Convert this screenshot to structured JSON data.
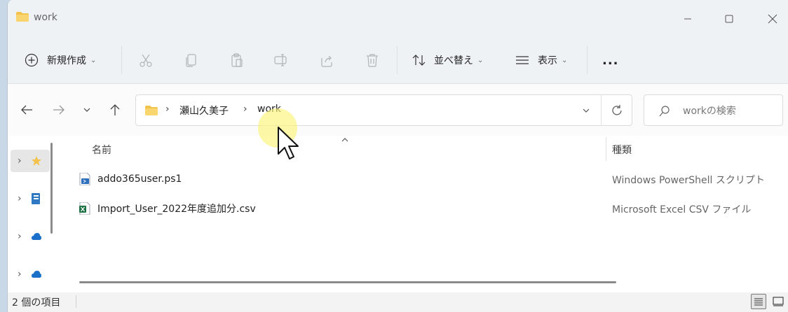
{
  "window": {
    "title": "work",
    "accent": "#f3c24a",
    "controls": [
      "minimize",
      "maximize",
      "close"
    ]
  },
  "toolbar": {
    "new_label": "新規作成",
    "sort_label": "並べ替え",
    "view_label": "表示",
    "more_label": "...",
    "icons": [
      "cut-icon",
      "copy-icon",
      "paste-icon",
      "rename-icon",
      "share-icon",
      "delete-icon"
    ]
  },
  "address": {
    "crumbs": [
      "瀬山久美子",
      "work"
    ],
    "search_placeholder": "workの検索"
  },
  "columns": {
    "name": "名前",
    "type": "種類"
  },
  "files": [
    {
      "name": "addo365user.ps1",
      "type": "Windows PowerShell スクリプト",
      "icon": "powershell-file-icon"
    },
    {
      "name": "Import_User_2022年度追加分.csv",
      "type": "Microsoft Excel CSV ファイル",
      "icon": "excel-csv-file-icon"
    }
  ],
  "status": {
    "count": "2 個の項目"
  }
}
